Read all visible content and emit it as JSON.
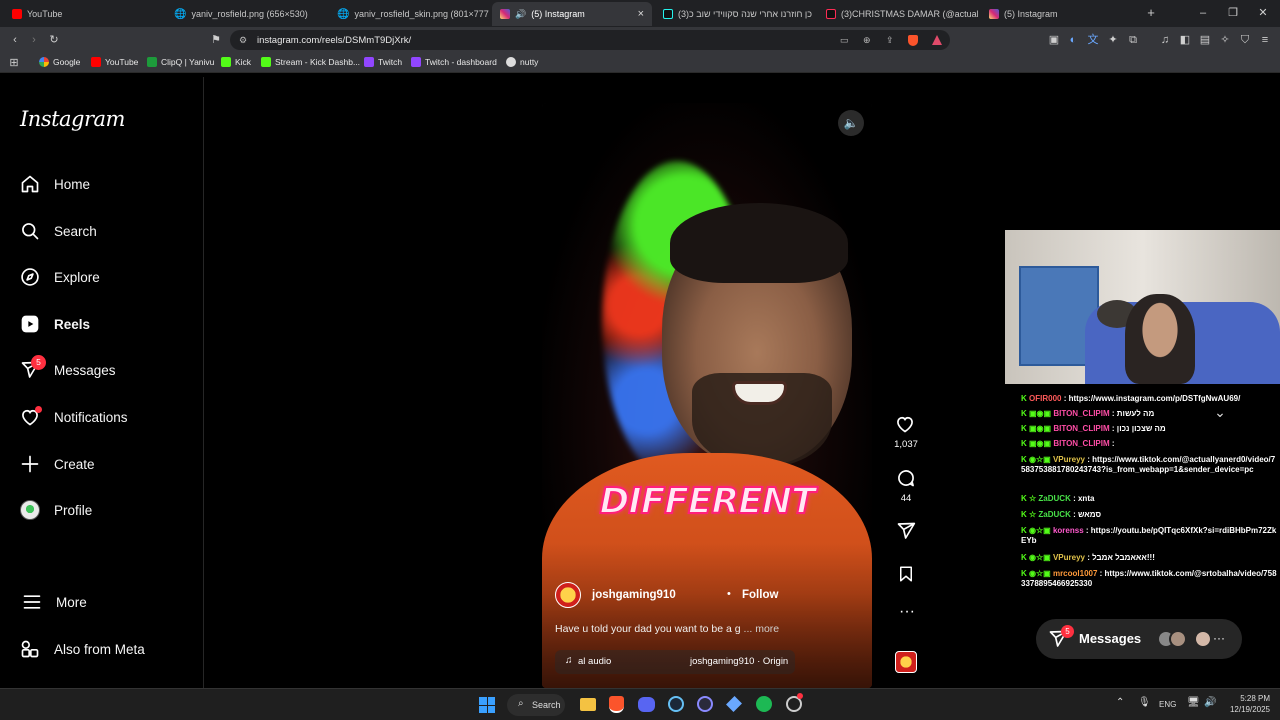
{
  "browser": {
    "tabs": [
      {
        "label": "YouTube",
        "color": "#ff0000"
      },
      {
        "label": "yaniv_rosfield.png (656×530)",
        "color": "#9aa0a6"
      },
      {
        "label": "yaniv_rosfield_skin.png (801×777)",
        "color": "#9aa0a6"
      },
      {
        "label": "(5) Instagram",
        "color": "#d62976"
      },
      {
        "label": "(3)ק כן חוזרנו אחרי שנה סקווידי שוב כ",
        "color": "#111111"
      },
      {
        "label": "(3)CHRISTMAS DAMAR (@actuallyar",
        "color": "#111111"
      },
      {
        "label": "(5) Instagram",
        "color": "#d62976"
      }
    ],
    "url": "instagram.com/reels/DSMmT9DjXrk/",
    "bookmarks": [
      {
        "label": "Google"
      },
      {
        "label": "YouTube"
      },
      {
        "label": "ClipQ | Yanivu"
      },
      {
        "label": "Kick"
      },
      {
        "label": "Stream - Kick Dashb..."
      },
      {
        "label": "Twitch"
      },
      {
        "label": "Twitch - dashboard"
      },
      {
        "label": "nutty"
      }
    ]
  },
  "sidebar": {
    "logo": "Instagram",
    "items": [
      {
        "label": "Home",
        "icon": "home-icon"
      },
      {
        "label": "Search",
        "icon": "search-icon"
      },
      {
        "label": "Explore",
        "icon": "compass-icon"
      },
      {
        "label": "Reels",
        "icon": "reels-icon"
      },
      {
        "label": "Messages",
        "icon": "messenger-icon",
        "badge": "5"
      },
      {
        "label": "Notifications",
        "icon": "heart-icon"
      },
      {
        "label": "Create",
        "icon": "plus-icon"
      },
      {
        "label": "Profile",
        "icon": "avatar-icon"
      }
    ],
    "more": "More",
    "meta": "Also from Meta"
  },
  "reel": {
    "overlay_text": "DIFFERENT",
    "username": "joshgaming910",
    "follow": "Follow",
    "caption": "Have u told your dad you want to be a g",
    "more": "... more",
    "audio_left": "al audio",
    "audio_right": "joshgaming910 · Origin",
    "likes": "1,037",
    "comments": "44"
  },
  "chat": {
    "lines": [
      {
        "user": "OFIR000",
        "text": ": https://www.instagram.com/p/DSTfgNwAU69/",
        "color": "#ff5a5a"
      },
      {
        "user": "BITON_CLIPIM",
        "text": ": מה לעשות",
        "color": "#ff4da6"
      },
      {
        "user": "BITON_CLIPIM",
        "text": ": מה שצכון נכון",
        "color": "#ff4da6"
      },
      {
        "user": "BITON_CLIPIM",
        "text": ":",
        "color": "#ff4da6"
      },
      {
        "user": "VPureyy",
        "text": ": https://www.tiktok.com/@actuallyanerd0/video/7583753881780243743?is_from_webapp=1&sender_device=pc",
        "color": "#e0c24a"
      },
      {
        "user": "ZaDUCK",
        "text": ": xnta",
        "color": "#48e048"
      },
      {
        "user": "ZaDUCK",
        "text": ": סמאש",
        "color": "#48e048"
      },
      {
        "user": "korenss",
        "text": ": https://youtu.be/pQITqc6XfXk?si=rdiBHbPm72ZkEYb",
        "color": "#ff5acd"
      },
      {
        "user": "VPureyy",
        "text": ": אאאמבל אמבל!!!",
        "color": "#e0c24a"
      },
      {
        "user": "mrcool1007",
        "text": ": https://www.tiktok.com/@srtobalha/video/7583378895466925330",
        "color": "#ff9a3a"
      }
    ]
  },
  "messages_pill": {
    "label": "Messages",
    "badge": "5"
  },
  "taskbar": {
    "search": "Search",
    "lang": "ENG",
    "time": "5:28 PM",
    "date": "12/19/2025"
  }
}
